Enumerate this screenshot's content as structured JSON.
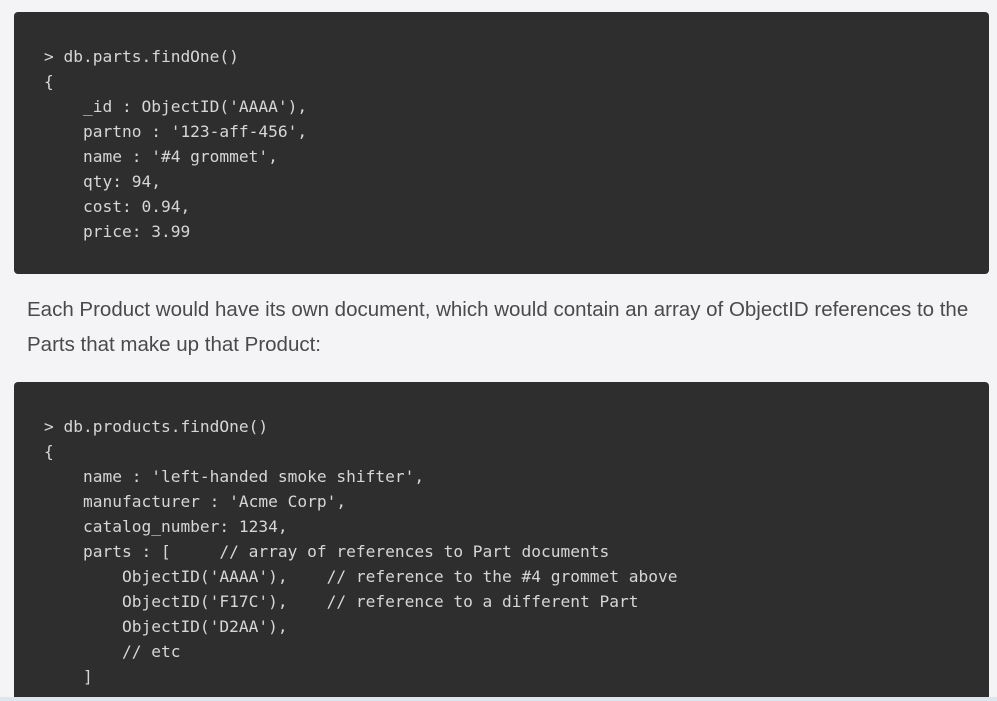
{
  "code_block_1": {
    "lines": [
      "> db.parts.findOne()",
      "{",
      "    _id : ObjectID('AAAA'),",
      "    partno : '123-aff-456',",
      "    name : '#4 grommet',",
      "    qty: 94,",
      "    cost: 0.94,",
      "    price: 3.99"
    ]
  },
  "paragraph": {
    "text": "Each Product would have its own document, which would contain an array of ObjectID references to the Parts that make up that Product:"
  },
  "code_block_2": {
    "lines": [
      "> db.products.findOne()",
      "{",
      "    name : 'left-handed smoke shifter',",
      "    manufacturer : 'Acme Corp',",
      "    catalog_number: 1234,",
      "    parts : [     // array of references to Part documents",
      "        ObjectID('AAAA'),    // reference to the #4 grommet above",
      "        ObjectID('F17C'),    // reference to a different Part",
      "        ObjectID('D2AA'),",
      "        // etc",
      "    ]"
    ]
  }
}
